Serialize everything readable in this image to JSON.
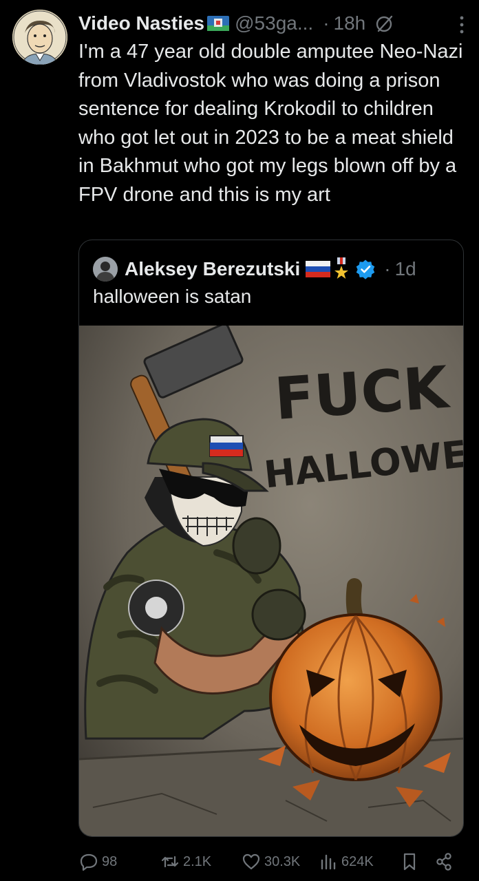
{
  "post": {
    "author_name": "Video Nasties",
    "handle": "@53ga...",
    "separator": "·",
    "time": "18h",
    "text": "I'm a 47 year old double amputee Neo-Nazi from Vladivostok who was doing a prison sentence for dealing Krokodil to children who got let out in 2023 to be a meat shield in Bakhmut who got my legs blown off by a FPV drone and this is my art",
    "icons": [
      "mute-icon",
      "more-icon"
    ]
  },
  "quote": {
    "author_name": "Aleksey Berezutski",
    "separator": "·",
    "time": "1d",
    "text": "halloween is satan",
    "verified": true,
    "image_text": {
      "line1": "FUCK",
      "line2": "HALLOWEEN"
    }
  },
  "actions": {
    "replies": "98",
    "reposts": "2.1K",
    "likes": "30.3K",
    "views": "624K"
  },
  "colors": {
    "background": "#000000",
    "text": "#e7e9ea",
    "muted": "#71767b",
    "border": "#2f3336",
    "verified": "#1d9bf0"
  }
}
